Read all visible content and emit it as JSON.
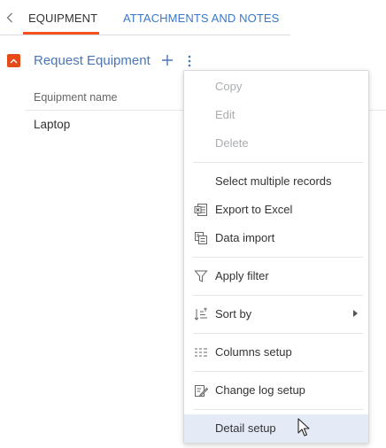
{
  "tabs": {
    "items": [
      {
        "label": "EQUIPMENT",
        "active": true
      },
      {
        "label": "ATTACHMENTS AND NOTES",
        "active": false
      }
    ]
  },
  "detail": {
    "title": "Request Equipment",
    "icons": [
      "chevron-up-icon",
      "plus-icon",
      "more-vertical-icon"
    ]
  },
  "grid": {
    "columns": [
      "Equipment name"
    ],
    "rows": [
      [
        "Laptop"
      ]
    ]
  },
  "menu": {
    "items": [
      {
        "label": "Copy",
        "disabled": true,
        "icon": ""
      },
      {
        "label": "Edit",
        "disabled": true,
        "icon": ""
      },
      {
        "label": "Delete",
        "disabled": true,
        "icon": ""
      },
      {
        "label": "Select multiple records",
        "disabled": false,
        "icon": ""
      },
      {
        "label": "Export to Excel",
        "disabled": false,
        "icon": "excel-export-icon"
      },
      {
        "label": "Data import",
        "disabled": false,
        "icon": "data-import-icon"
      },
      {
        "label": "Apply filter",
        "disabled": false,
        "icon": "filter-icon"
      },
      {
        "label": "Sort by",
        "disabled": false,
        "icon": "sort-icon",
        "submenu": true
      },
      {
        "label": "Columns setup",
        "disabled": false,
        "icon": "columns-icon"
      },
      {
        "label": "Change log setup",
        "disabled": false,
        "icon": "change-log-icon"
      },
      {
        "label": "Detail setup",
        "disabled": false,
        "icon": "",
        "hovered": true
      }
    ]
  },
  "colors": {
    "accent": "#f4511e",
    "link": "#3a78c8",
    "title": "#4a76b8",
    "hover": "#e4ebf7"
  }
}
